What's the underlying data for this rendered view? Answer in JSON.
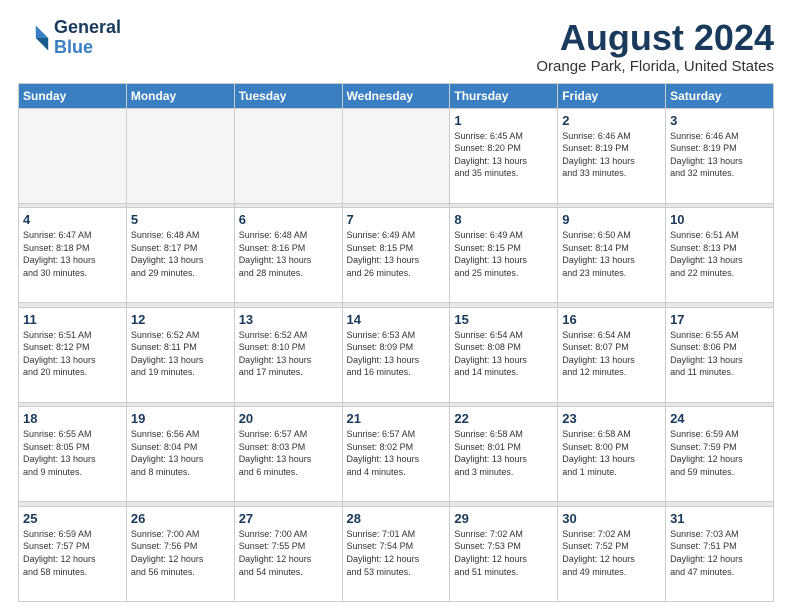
{
  "logo": {
    "line1": "General",
    "line2": "Blue"
  },
  "title": "August 2024",
  "subtitle": "Orange Park, Florida, United States",
  "weekdays": [
    "Sunday",
    "Monday",
    "Tuesday",
    "Wednesday",
    "Thursday",
    "Friday",
    "Saturday"
  ],
  "weeks": [
    [
      {
        "day": "",
        "info": ""
      },
      {
        "day": "",
        "info": ""
      },
      {
        "day": "",
        "info": ""
      },
      {
        "day": "",
        "info": ""
      },
      {
        "day": "1",
        "info": "Sunrise: 6:45 AM\nSunset: 8:20 PM\nDaylight: 13 hours\nand 35 minutes."
      },
      {
        "day": "2",
        "info": "Sunrise: 6:46 AM\nSunset: 8:19 PM\nDaylight: 13 hours\nand 33 minutes."
      },
      {
        "day": "3",
        "info": "Sunrise: 6:46 AM\nSunset: 8:19 PM\nDaylight: 13 hours\nand 32 minutes."
      }
    ],
    [
      {
        "day": "4",
        "info": "Sunrise: 6:47 AM\nSunset: 8:18 PM\nDaylight: 13 hours\nand 30 minutes."
      },
      {
        "day": "5",
        "info": "Sunrise: 6:48 AM\nSunset: 8:17 PM\nDaylight: 13 hours\nand 29 minutes."
      },
      {
        "day": "6",
        "info": "Sunrise: 6:48 AM\nSunset: 8:16 PM\nDaylight: 13 hours\nand 28 minutes."
      },
      {
        "day": "7",
        "info": "Sunrise: 6:49 AM\nSunset: 8:15 PM\nDaylight: 13 hours\nand 26 minutes."
      },
      {
        "day": "8",
        "info": "Sunrise: 6:49 AM\nSunset: 8:15 PM\nDaylight: 13 hours\nand 25 minutes."
      },
      {
        "day": "9",
        "info": "Sunrise: 6:50 AM\nSunset: 8:14 PM\nDaylight: 13 hours\nand 23 minutes."
      },
      {
        "day": "10",
        "info": "Sunrise: 6:51 AM\nSunset: 8:13 PM\nDaylight: 13 hours\nand 22 minutes."
      }
    ],
    [
      {
        "day": "11",
        "info": "Sunrise: 6:51 AM\nSunset: 8:12 PM\nDaylight: 13 hours\nand 20 minutes."
      },
      {
        "day": "12",
        "info": "Sunrise: 6:52 AM\nSunset: 8:11 PM\nDaylight: 13 hours\nand 19 minutes."
      },
      {
        "day": "13",
        "info": "Sunrise: 6:52 AM\nSunset: 8:10 PM\nDaylight: 13 hours\nand 17 minutes."
      },
      {
        "day": "14",
        "info": "Sunrise: 6:53 AM\nSunset: 8:09 PM\nDaylight: 13 hours\nand 16 minutes."
      },
      {
        "day": "15",
        "info": "Sunrise: 6:54 AM\nSunset: 8:08 PM\nDaylight: 13 hours\nand 14 minutes."
      },
      {
        "day": "16",
        "info": "Sunrise: 6:54 AM\nSunset: 8:07 PM\nDaylight: 13 hours\nand 12 minutes."
      },
      {
        "day": "17",
        "info": "Sunrise: 6:55 AM\nSunset: 8:06 PM\nDaylight: 13 hours\nand 11 minutes."
      }
    ],
    [
      {
        "day": "18",
        "info": "Sunrise: 6:55 AM\nSunset: 8:05 PM\nDaylight: 13 hours\nand 9 minutes."
      },
      {
        "day": "19",
        "info": "Sunrise: 6:56 AM\nSunset: 8:04 PM\nDaylight: 13 hours\nand 8 minutes."
      },
      {
        "day": "20",
        "info": "Sunrise: 6:57 AM\nSunset: 8:03 PM\nDaylight: 13 hours\nand 6 minutes."
      },
      {
        "day": "21",
        "info": "Sunrise: 6:57 AM\nSunset: 8:02 PM\nDaylight: 13 hours\nand 4 minutes."
      },
      {
        "day": "22",
        "info": "Sunrise: 6:58 AM\nSunset: 8:01 PM\nDaylight: 13 hours\nand 3 minutes."
      },
      {
        "day": "23",
        "info": "Sunrise: 6:58 AM\nSunset: 8:00 PM\nDaylight: 13 hours\nand 1 minute."
      },
      {
        "day": "24",
        "info": "Sunrise: 6:59 AM\nSunset: 7:59 PM\nDaylight: 12 hours\nand 59 minutes."
      }
    ],
    [
      {
        "day": "25",
        "info": "Sunrise: 6:59 AM\nSunset: 7:57 PM\nDaylight: 12 hours\nand 58 minutes."
      },
      {
        "day": "26",
        "info": "Sunrise: 7:00 AM\nSunset: 7:56 PM\nDaylight: 12 hours\nand 56 minutes."
      },
      {
        "day": "27",
        "info": "Sunrise: 7:00 AM\nSunset: 7:55 PM\nDaylight: 12 hours\nand 54 minutes."
      },
      {
        "day": "28",
        "info": "Sunrise: 7:01 AM\nSunset: 7:54 PM\nDaylight: 12 hours\nand 53 minutes."
      },
      {
        "day": "29",
        "info": "Sunrise: 7:02 AM\nSunset: 7:53 PM\nDaylight: 12 hours\nand 51 minutes."
      },
      {
        "day": "30",
        "info": "Sunrise: 7:02 AM\nSunset: 7:52 PM\nDaylight: 12 hours\nand 49 minutes."
      },
      {
        "day": "31",
        "info": "Sunrise: 7:03 AM\nSunset: 7:51 PM\nDaylight: 12 hours\nand 47 minutes."
      }
    ]
  ]
}
